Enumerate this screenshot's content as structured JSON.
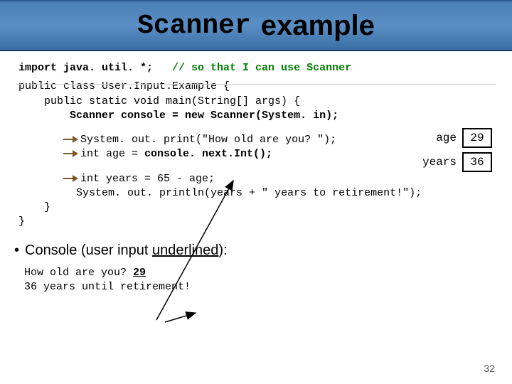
{
  "title": {
    "mono": "Scanner",
    "sans": "example"
  },
  "code": {
    "l1a": "import java. util. *;",
    "l1b": "   // so that I can use Scanner",
    "l2": "public class User.Input.Example {",
    "l3": "    public static void main(String[] args) {",
    "l4a": "        Scanner console = new Scanner(System. in);",
    "l5": "System. out. print(\"How old are you? \");",
    "l6a": "int age = ",
    "l6b": "console. next.Int();",
    "l7": "int years = 65 - age;",
    "l8": "System. out. println(years + \" years to retirement!\");",
    "l9": "    }",
    "l10": "}"
  },
  "boxes": {
    "age_label": "age",
    "age_val": "29",
    "years_label": "years",
    "years_val": "36"
  },
  "bullet": "Console (user input ",
  "bullet_u": "underlined",
  "bullet_end": "):",
  "console": {
    "line1a": "How old are you? ",
    "line1b": "29",
    "line2": "36 years until retirement!"
  },
  "page": "32"
}
